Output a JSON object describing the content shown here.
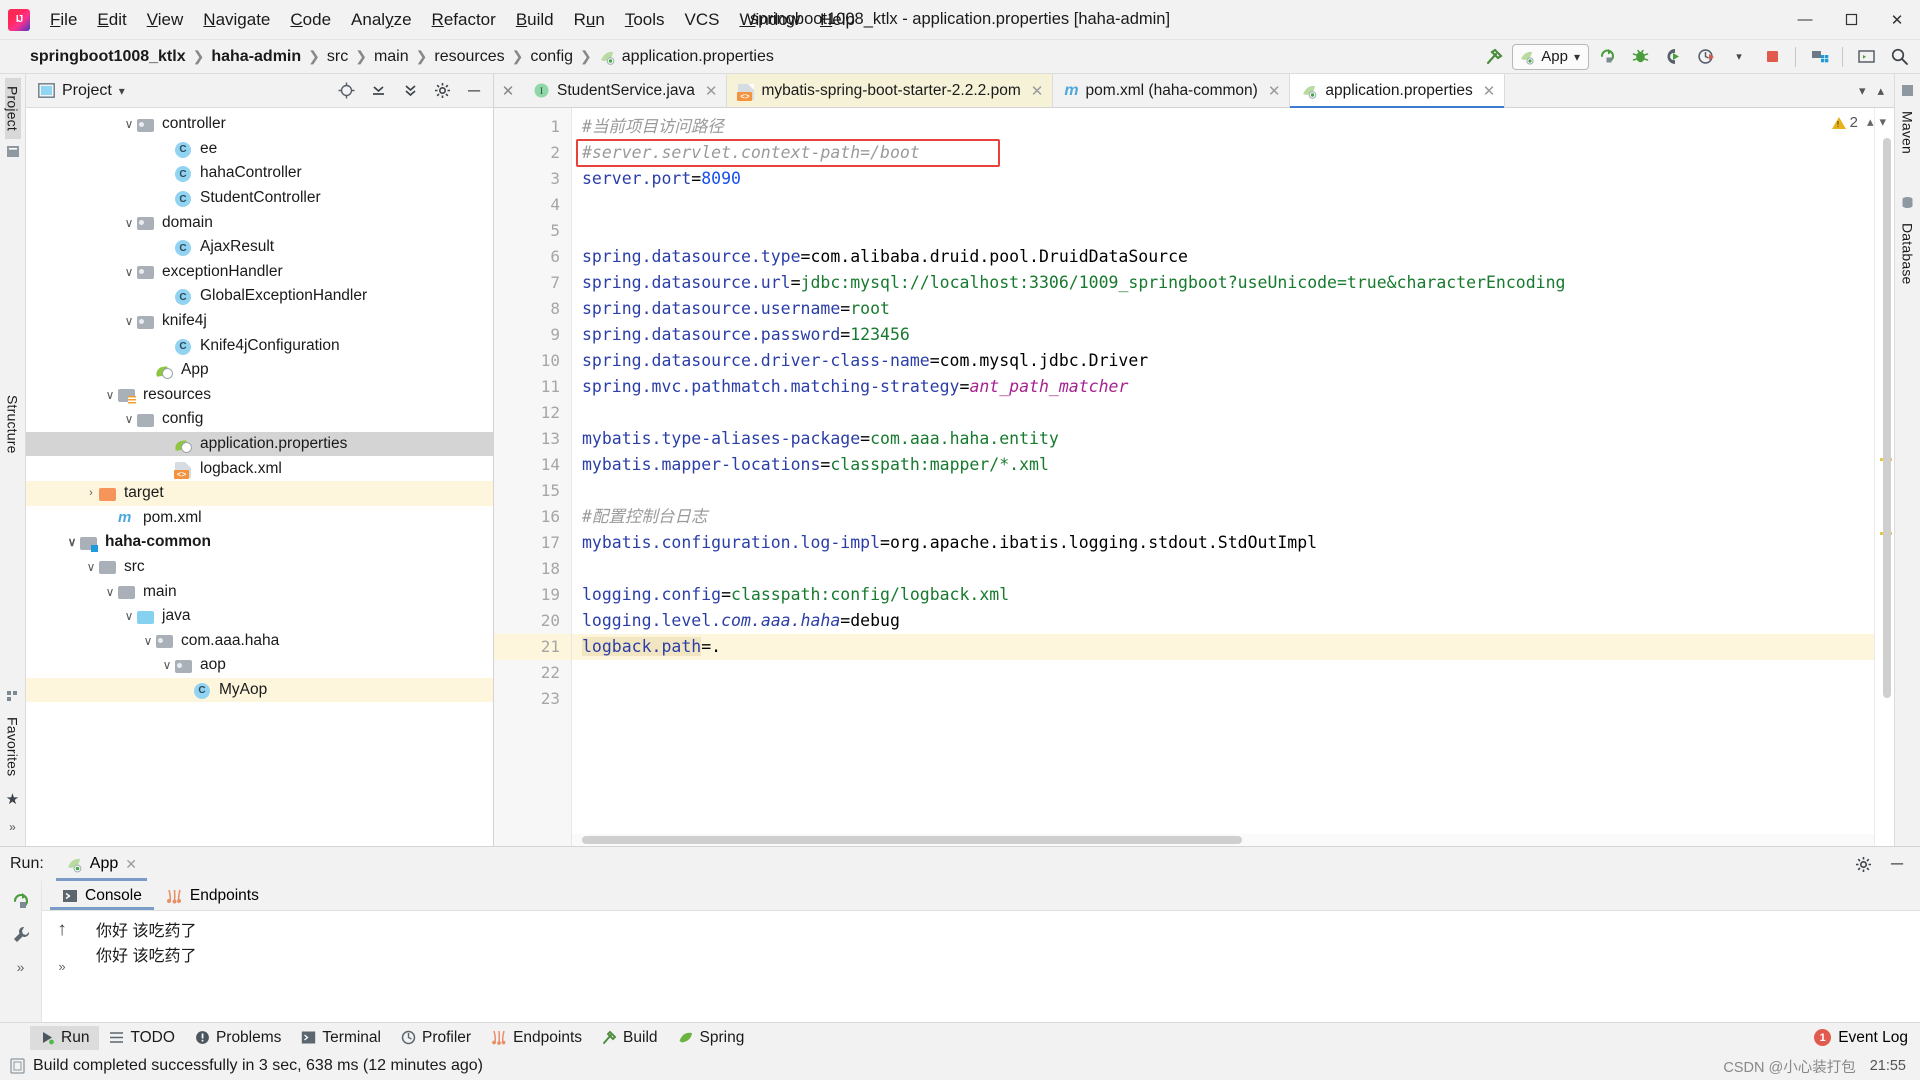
{
  "window": {
    "title": "springboot1008_ktlx - application.properties [haha-admin]",
    "minimize": "—",
    "maximize": "❐",
    "close": "✕"
  },
  "menubar": [
    {
      "label": "File",
      "mnemonic": "F"
    },
    {
      "label": "Edit",
      "mnemonic": "E"
    },
    {
      "label": "View",
      "mnemonic": "V"
    },
    {
      "label": "Navigate",
      "mnemonic": "N"
    },
    {
      "label": "Code",
      "mnemonic": "C"
    },
    {
      "label": "Analyze",
      "mnemonic": "y"
    },
    {
      "label": "Refactor",
      "mnemonic": "R"
    },
    {
      "label": "Build",
      "mnemonic": "B"
    },
    {
      "label": "Run",
      "mnemonic": "u"
    },
    {
      "label": "Tools",
      "mnemonic": "T"
    },
    {
      "label": "VCS",
      "mnemonic": ""
    },
    {
      "label": "Window",
      "mnemonic": "W"
    },
    {
      "label": "Help",
      "mnemonic": "H"
    }
  ],
  "breadcrumbs": [
    {
      "label": "springboot1008_ktlx",
      "bold": true
    },
    {
      "label": "haha-admin",
      "bold": true
    },
    {
      "label": "src",
      "bold": false
    },
    {
      "label": "main",
      "bold": false
    },
    {
      "label": "resources",
      "bold": false
    },
    {
      "label": "config",
      "bold": false
    },
    {
      "label": "application.properties",
      "bold": false,
      "icon": "spring-leaf-icon"
    }
  ],
  "toolbar": {
    "run_config": "App",
    "dropdown_caret": "▾",
    "icons": [
      "build-hammer-icon",
      "rerun-icon",
      "debug-bug-icon",
      "run-with-coverage-icon",
      "profiler-icon",
      "stop-icon",
      "project-structure-icon",
      "terminal-icon",
      "search-everywhere-icon"
    ]
  },
  "left_strip": {
    "project_label": "Project",
    "structure_label": "Structure",
    "favorites_label": "Favorites"
  },
  "right_strip": {
    "maven_label": "Maven",
    "database_label": "Database"
  },
  "project_panel": {
    "title": "Project",
    "caret": "▾",
    "header_icons": [
      "locate-icon",
      "collapse-all-icon",
      "expand-all-icon",
      "settings-gear-icon",
      "hide-icon"
    ],
    "tree": [
      {
        "label": "controller",
        "indent": 5,
        "icon": "folder-package",
        "expanded": true,
        "chevron": "ⱟ"
      },
      {
        "label": "ee",
        "indent": 7,
        "icon": "class",
        "expanded": null,
        "chevron": ""
      },
      {
        "label": "hahaController",
        "indent": 7,
        "icon": "class",
        "expanded": null,
        "chevron": ""
      },
      {
        "label": "StudentController",
        "indent": 7,
        "icon": "class",
        "expanded": null,
        "chevron": ""
      },
      {
        "label": "domain",
        "indent": 5,
        "icon": "folder-package",
        "expanded": true,
        "chevron": "ⱟ"
      },
      {
        "label": "AjaxResult",
        "indent": 7,
        "icon": "class",
        "expanded": null,
        "chevron": ""
      },
      {
        "label": "exceptionHandler",
        "indent": 5,
        "icon": "folder-package",
        "expanded": true,
        "chevron": "ⱟ"
      },
      {
        "label": "GlobalExceptionHandler",
        "indent": 7,
        "icon": "class",
        "expanded": null,
        "chevron": ""
      },
      {
        "label": "knife4j",
        "indent": 5,
        "icon": "folder-package",
        "expanded": true,
        "chevron": "ⱟ"
      },
      {
        "label": "Knife4jConfiguration",
        "indent": 7,
        "icon": "class",
        "expanded": null,
        "chevron": ""
      },
      {
        "label": "App",
        "indent": 6,
        "icon": "spring-boot-app",
        "expanded": null,
        "chevron": ""
      },
      {
        "label": "resources",
        "indent": 4,
        "icon": "folder-resources",
        "expanded": true,
        "chevron": "ⱟ"
      },
      {
        "label": "config",
        "indent": 5,
        "icon": "folder-plain",
        "expanded": true,
        "chevron": "ⱟ"
      },
      {
        "label": "application.properties",
        "indent": 7,
        "icon": "spring-leaf",
        "expanded": null,
        "chevron": "",
        "selected": true
      },
      {
        "label": "logback.xml",
        "indent": 7,
        "icon": "xml-file",
        "expanded": null,
        "chevron": ""
      },
      {
        "label": "target",
        "indent": 3,
        "icon": "folder-orange",
        "expanded": false,
        "chevron": "›",
        "highlight": true
      },
      {
        "label": "pom.xml",
        "indent": 4,
        "icon": "maven-m",
        "expanded": null,
        "chevron": ""
      },
      {
        "label": "haha-common",
        "indent": 2,
        "icon": "module",
        "expanded": true,
        "chevron": "ⱟ",
        "bold": true
      },
      {
        "label": "src",
        "indent": 3,
        "icon": "folder-plain",
        "expanded": true,
        "chevron": "ⱟ"
      },
      {
        "label": "main",
        "indent": 4,
        "icon": "folder-plain",
        "expanded": true,
        "chevron": "ⱟ"
      },
      {
        "label": "java",
        "indent": 5,
        "icon": "folder-blue",
        "expanded": true,
        "chevron": "ⱟ"
      },
      {
        "label": "com.aaa.haha",
        "indent": 6,
        "icon": "folder-package",
        "expanded": true,
        "chevron": "ⱟ"
      },
      {
        "label": "aop",
        "indent": 7,
        "icon": "folder-package",
        "expanded": true,
        "chevron": "ⱟ"
      },
      {
        "label": "MyAop",
        "indent": 8,
        "icon": "class",
        "expanded": null,
        "chevron": "",
        "highlight2": true
      }
    ]
  },
  "editor_tabs": [
    {
      "label": "StudentService.java",
      "icon": "interface-icon",
      "state": "normal",
      "close": "✕"
    },
    {
      "label": "mybatis-spring-boot-starter-2.2.2.pom",
      "icon": "xml-icon",
      "state": "pom",
      "close": "✕"
    },
    {
      "label": "pom.xml (haha-common)",
      "icon": "maven-icon",
      "state": "normal",
      "close": "✕"
    },
    {
      "label": "application.properties",
      "icon": "spring-leaf-icon",
      "state": "active",
      "close": "✕"
    }
  ],
  "editor": {
    "warning_count": "2",
    "lines": [
      {
        "n": 1,
        "tokens": [
          {
            "t": "#当前项目访问路径",
            "c": "cm"
          }
        ]
      },
      {
        "n": 2,
        "tokens": [
          {
            "t": "#server.servlet.context-path=/boot",
            "c": "cm"
          }
        ],
        "boxed": true
      },
      {
        "n": 3,
        "tokens": [
          {
            "t": "server.port",
            "c": "k"
          },
          {
            "t": "=",
            "c": "plain"
          },
          {
            "t": "8090",
            "c": "n"
          }
        ]
      },
      {
        "n": 4,
        "tokens": []
      },
      {
        "n": 5,
        "tokens": []
      },
      {
        "n": 6,
        "tokens": [
          {
            "t": "spring.datasource.type",
            "c": "k"
          },
          {
            "t": "=",
            "c": "plain"
          },
          {
            "t": "com.alibaba.druid.pool.DruidDataSource",
            "c": "plain"
          }
        ]
      },
      {
        "n": 7,
        "tokens": [
          {
            "t": "spring.datasource.url",
            "c": "k"
          },
          {
            "t": "=",
            "c": "plain"
          },
          {
            "t": "jdbc:mysql://localhost:3306/1009_springboot?useUnicode=true&characterEncoding",
            "c": "v"
          }
        ]
      },
      {
        "n": 8,
        "tokens": [
          {
            "t": "spring.datasource.username",
            "c": "k"
          },
          {
            "t": "=",
            "c": "plain"
          },
          {
            "t": "root",
            "c": "v"
          }
        ]
      },
      {
        "n": 9,
        "tokens": [
          {
            "t": "spring.datasource.password",
            "c": "k"
          },
          {
            "t": "=",
            "c": "plain"
          },
          {
            "t": "123456",
            "c": "v"
          }
        ]
      },
      {
        "n": 10,
        "tokens": [
          {
            "t": "spring.datasource.driver-class-name",
            "c": "k"
          },
          {
            "t": "=",
            "c": "plain"
          },
          {
            "t": "com.mysql.jdbc.Driver",
            "c": "plain"
          }
        ]
      },
      {
        "n": 11,
        "tokens": [
          {
            "t": "spring.mvc.pathmatch.matching-strategy",
            "c": "k"
          },
          {
            "t": "=",
            "c": "plain"
          },
          {
            "t": "ant_path_matcher",
            "c": "it"
          }
        ]
      },
      {
        "n": 12,
        "tokens": []
      },
      {
        "n": 13,
        "tokens": [
          {
            "t": "mybatis.type-aliases-package",
            "c": "k"
          },
          {
            "t": "=",
            "c": "plain"
          },
          {
            "t": "com.aaa.haha.entity",
            "c": "v"
          }
        ]
      },
      {
        "n": 14,
        "tokens": [
          {
            "t": "mybatis.mapper-locations",
            "c": "k"
          },
          {
            "t": "=",
            "c": "plain"
          },
          {
            "t": "classpath:mapper/*.xml",
            "c": "v"
          }
        ]
      },
      {
        "n": 15,
        "tokens": []
      },
      {
        "n": 16,
        "tokens": [
          {
            "t": "#配置控制台日志",
            "c": "cm"
          }
        ]
      },
      {
        "n": 17,
        "tokens": [
          {
            "t": "mybatis.configuration.log-impl",
            "c": "k"
          },
          {
            "t": "=",
            "c": "plain"
          },
          {
            "t": "org.apache.ibatis.logging.stdout.StdOutImpl",
            "c": "plain"
          }
        ]
      },
      {
        "n": 18,
        "tokens": []
      },
      {
        "n": 19,
        "tokens": [
          {
            "t": "logging.config",
            "c": "k"
          },
          {
            "t": "=",
            "c": "plain"
          },
          {
            "t": "classpath:config/logback.xml",
            "c": "v"
          }
        ]
      },
      {
        "n": 20,
        "tokens": [
          {
            "t": "logging.level.",
            "c": "k"
          },
          {
            "t": "com.aaa.haha",
            "c": "itk"
          },
          {
            "t": "=",
            "c": "plain"
          },
          {
            "t": "debug",
            "c": "plain"
          }
        ]
      },
      {
        "n": 21,
        "tokens": [
          {
            "t": "logback.path",
            "c": "k hlword"
          },
          {
            "t": "=",
            "c": "plain"
          },
          {
            "t": ".",
            "c": "plain"
          }
        ],
        "highlight": true
      },
      {
        "n": 22,
        "tokens": []
      },
      {
        "n": 23,
        "tokens": []
      }
    ]
  },
  "run_panel": {
    "run_label": "Run:",
    "config_name": "App",
    "close": "✕",
    "tabs": [
      {
        "label": "Console",
        "icon": "console-icon",
        "active": true
      },
      {
        "label": "Endpoints",
        "icon": "endpoints-icon",
        "active": false
      }
    ],
    "console_output": [
      "你好  该吃药了",
      "你好  该吃药了"
    ],
    "side_icons": [
      "rerun-icon",
      "settings-wrench-icon",
      "more-icon"
    ],
    "scroll_up_icon": "↑",
    "header_icons": [
      "settings-gear-icon",
      "hide-icon"
    ]
  },
  "tool_strip": {
    "items": [
      {
        "label": "Run",
        "icon": "run-icon",
        "selected": true
      },
      {
        "label": "TODO",
        "icon": "todo-icon",
        "selected": false
      },
      {
        "label": "Problems",
        "icon": "problems-icon",
        "selected": false
      },
      {
        "label": "Terminal",
        "icon": "terminal-icon",
        "selected": false
      },
      {
        "label": "Profiler",
        "icon": "profiler-icon",
        "selected": false
      },
      {
        "label": "Endpoints",
        "icon": "endpoints-icon",
        "selected": false
      },
      {
        "label": "Build",
        "icon": "build-icon",
        "selected": false
      },
      {
        "label": "Spring",
        "icon": "spring-icon",
        "selected": false
      }
    ],
    "event_log": "Event Log",
    "event_log_count": "1"
  },
  "statusbar": {
    "message": "Build completed successfully in 3 sec, 638 ms (12 minutes ago)",
    "watermark": "CSDN @小心装打包",
    "clock": "21:55"
  }
}
